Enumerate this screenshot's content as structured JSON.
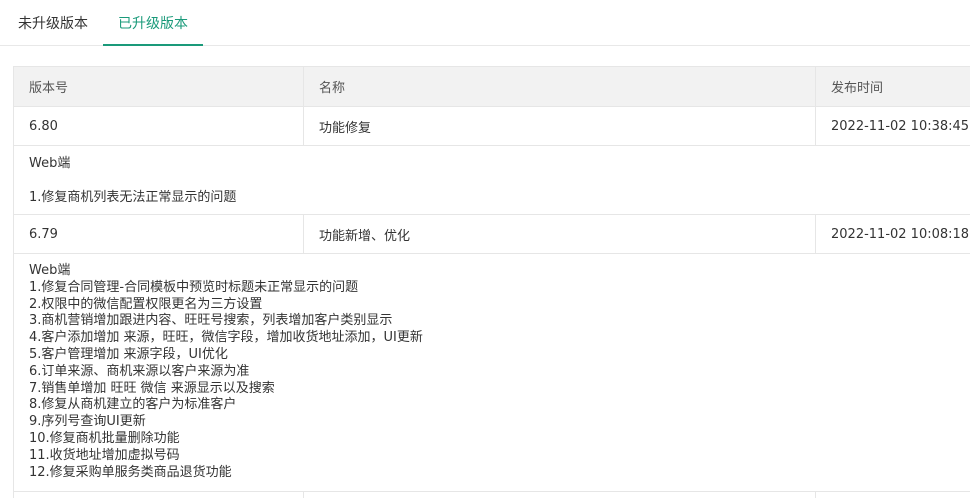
{
  "tabs": [
    {
      "label": "未升级版本",
      "active": false
    },
    {
      "label": "已升级版本",
      "active": true
    }
  ],
  "accent_color": "#1a9a7a",
  "table": {
    "headers": [
      "版本号",
      "名称",
      "发布时间"
    ],
    "rows": [
      {
        "version": "6.80",
        "name": "功能修复",
        "time": "2022-11-02 10:38:45",
        "details": [
          "Web端",
          "1.修复商机列表无法正常显示的问题"
        ]
      },
      {
        "version": "6.79",
        "name": "功能新增、优化",
        "time": "2022-11-02 10:08:18",
        "details": [
          "Web端",
          "1.修复合同管理-合同模板中预览时标题未正常显示的问题",
          "2.权限中的微信配置权限更名为三方设置",
          "3.商机营销增加跟进内容、旺旺号搜索，列表增加客户类别显示",
          "4.客户添加增加 来源，旺旺，微信字段，增加收货地址添加，UI更新",
          "5.客户管理增加 来源字段，UI优化",
          "6.订单来源、商机来源以客户来源为准",
          "7.销售单增加 旺旺 微信 来源显示以及搜索",
          "8.修复从商机建立的客户为标准客户",
          "9.序列号查询UI更新",
          "10.修复商机批量删除功能",
          "11.收货地址增加虚拟号码",
          "12.修复采购单服务类商品退货功能"
        ]
      }
    ]
  }
}
